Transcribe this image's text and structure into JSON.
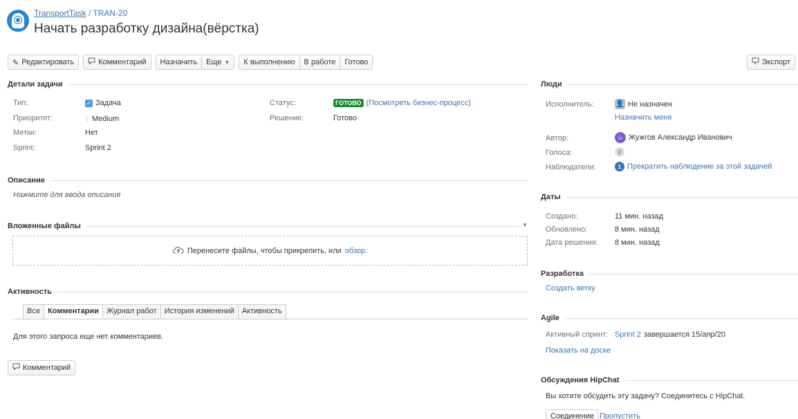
{
  "header": {
    "project_link": "TransportTask",
    "separator": "/",
    "issue_key": "TRAN-20",
    "title": "Начать разработку дизайна(вёрстка)"
  },
  "toolbar": {
    "edit": "Редактировать",
    "comment": "Комментарий",
    "assign": "Назначить",
    "more": "Еще",
    "to_do": "К выполнению",
    "in_progress": "В работе",
    "done": "Готово",
    "export": "Экспорт"
  },
  "details": {
    "heading": "Детали задачи",
    "type_label": "Тип:",
    "type_value": "Задача",
    "priority_label": "Приоритет:",
    "priority_value": "Medium",
    "labels_label": "Метки:",
    "labels_value": "Нет",
    "sprint_label": "Sprint:",
    "sprint_value": "Sprint 2",
    "status_label": "Статус:",
    "status_value": "ГОТОВО",
    "status_link": "(Посмотреть бизнес-процесс)",
    "resolution_label": "Решение:",
    "resolution_value": "Готово",
    "status_color": "#14892c"
  },
  "description": {
    "heading": "Описание",
    "placeholder": "Нажмите для ввода описания"
  },
  "attachments": {
    "heading": "Вложенные файлы",
    "drop_text": "Перенесите файлы, чтобы прикрепить, или",
    "browse_link": "обзор."
  },
  "activity": {
    "heading": "Активность",
    "tabs": [
      "Все",
      "Комментарии",
      "Журнал работ",
      "История изменений",
      "Активность"
    ],
    "active_tab": "Комментарии",
    "empty_text": "Для этого запроса еще нет комментариев.",
    "comment_button": "Комментарий"
  },
  "people": {
    "heading": "Люди",
    "assignee_label": "Исполнитель:",
    "assignee_value": "Не назначен",
    "assign_me": "Назначить меня",
    "reporter_label": "Автор:",
    "reporter_value": "Жужгов Александр Иванович",
    "votes_label": "Голоса:",
    "votes_value": "0",
    "watchers_label": "Наблюдатели:",
    "watchers_count": "1",
    "watchers_link": "Прекратить наблюдение за этой задачей"
  },
  "dates": {
    "heading": "Даты",
    "created_label": "Создано:",
    "created_value": "11 мин. назад",
    "updated_label": "Обновлено:",
    "updated_value": "8 мин. назад",
    "resolved_label": "Дата решения:",
    "resolved_value": "8 мин. назад"
  },
  "development": {
    "heading": "Разработка",
    "create_branch": "Создать ветку"
  },
  "agile": {
    "heading": "Agile",
    "active_sprint_label": "Активный спринт:",
    "sprint_link": "Sprint 2",
    "sprint_ends": "завершается 15/апр/20",
    "show_on_board": "Показать на доске"
  },
  "hipchat": {
    "heading": "Обсуждения HipChat",
    "prompt": "Вы хотите обсудить эту задачу? Соединитесь с HipChat.",
    "connect": "Соединение",
    "skip": "Пропустить"
  },
  "icons": {
    "project_avatar": "project-avatar-icon",
    "edit": "pencil-icon",
    "comment": "comment-bubble-icon",
    "more": "chevron-down-icon",
    "export": "export-icon",
    "type": "checkbox-task-icon",
    "priority": "arrow-up-icon",
    "upload": "cloud-upload-icon",
    "collapse": "chevron-down-icon"
  },
  "colors": {
    "link": "#3b73af",
    "priority_arrow": "#f79232",
    "task_icon": "#4a9ad6"
  }
}
